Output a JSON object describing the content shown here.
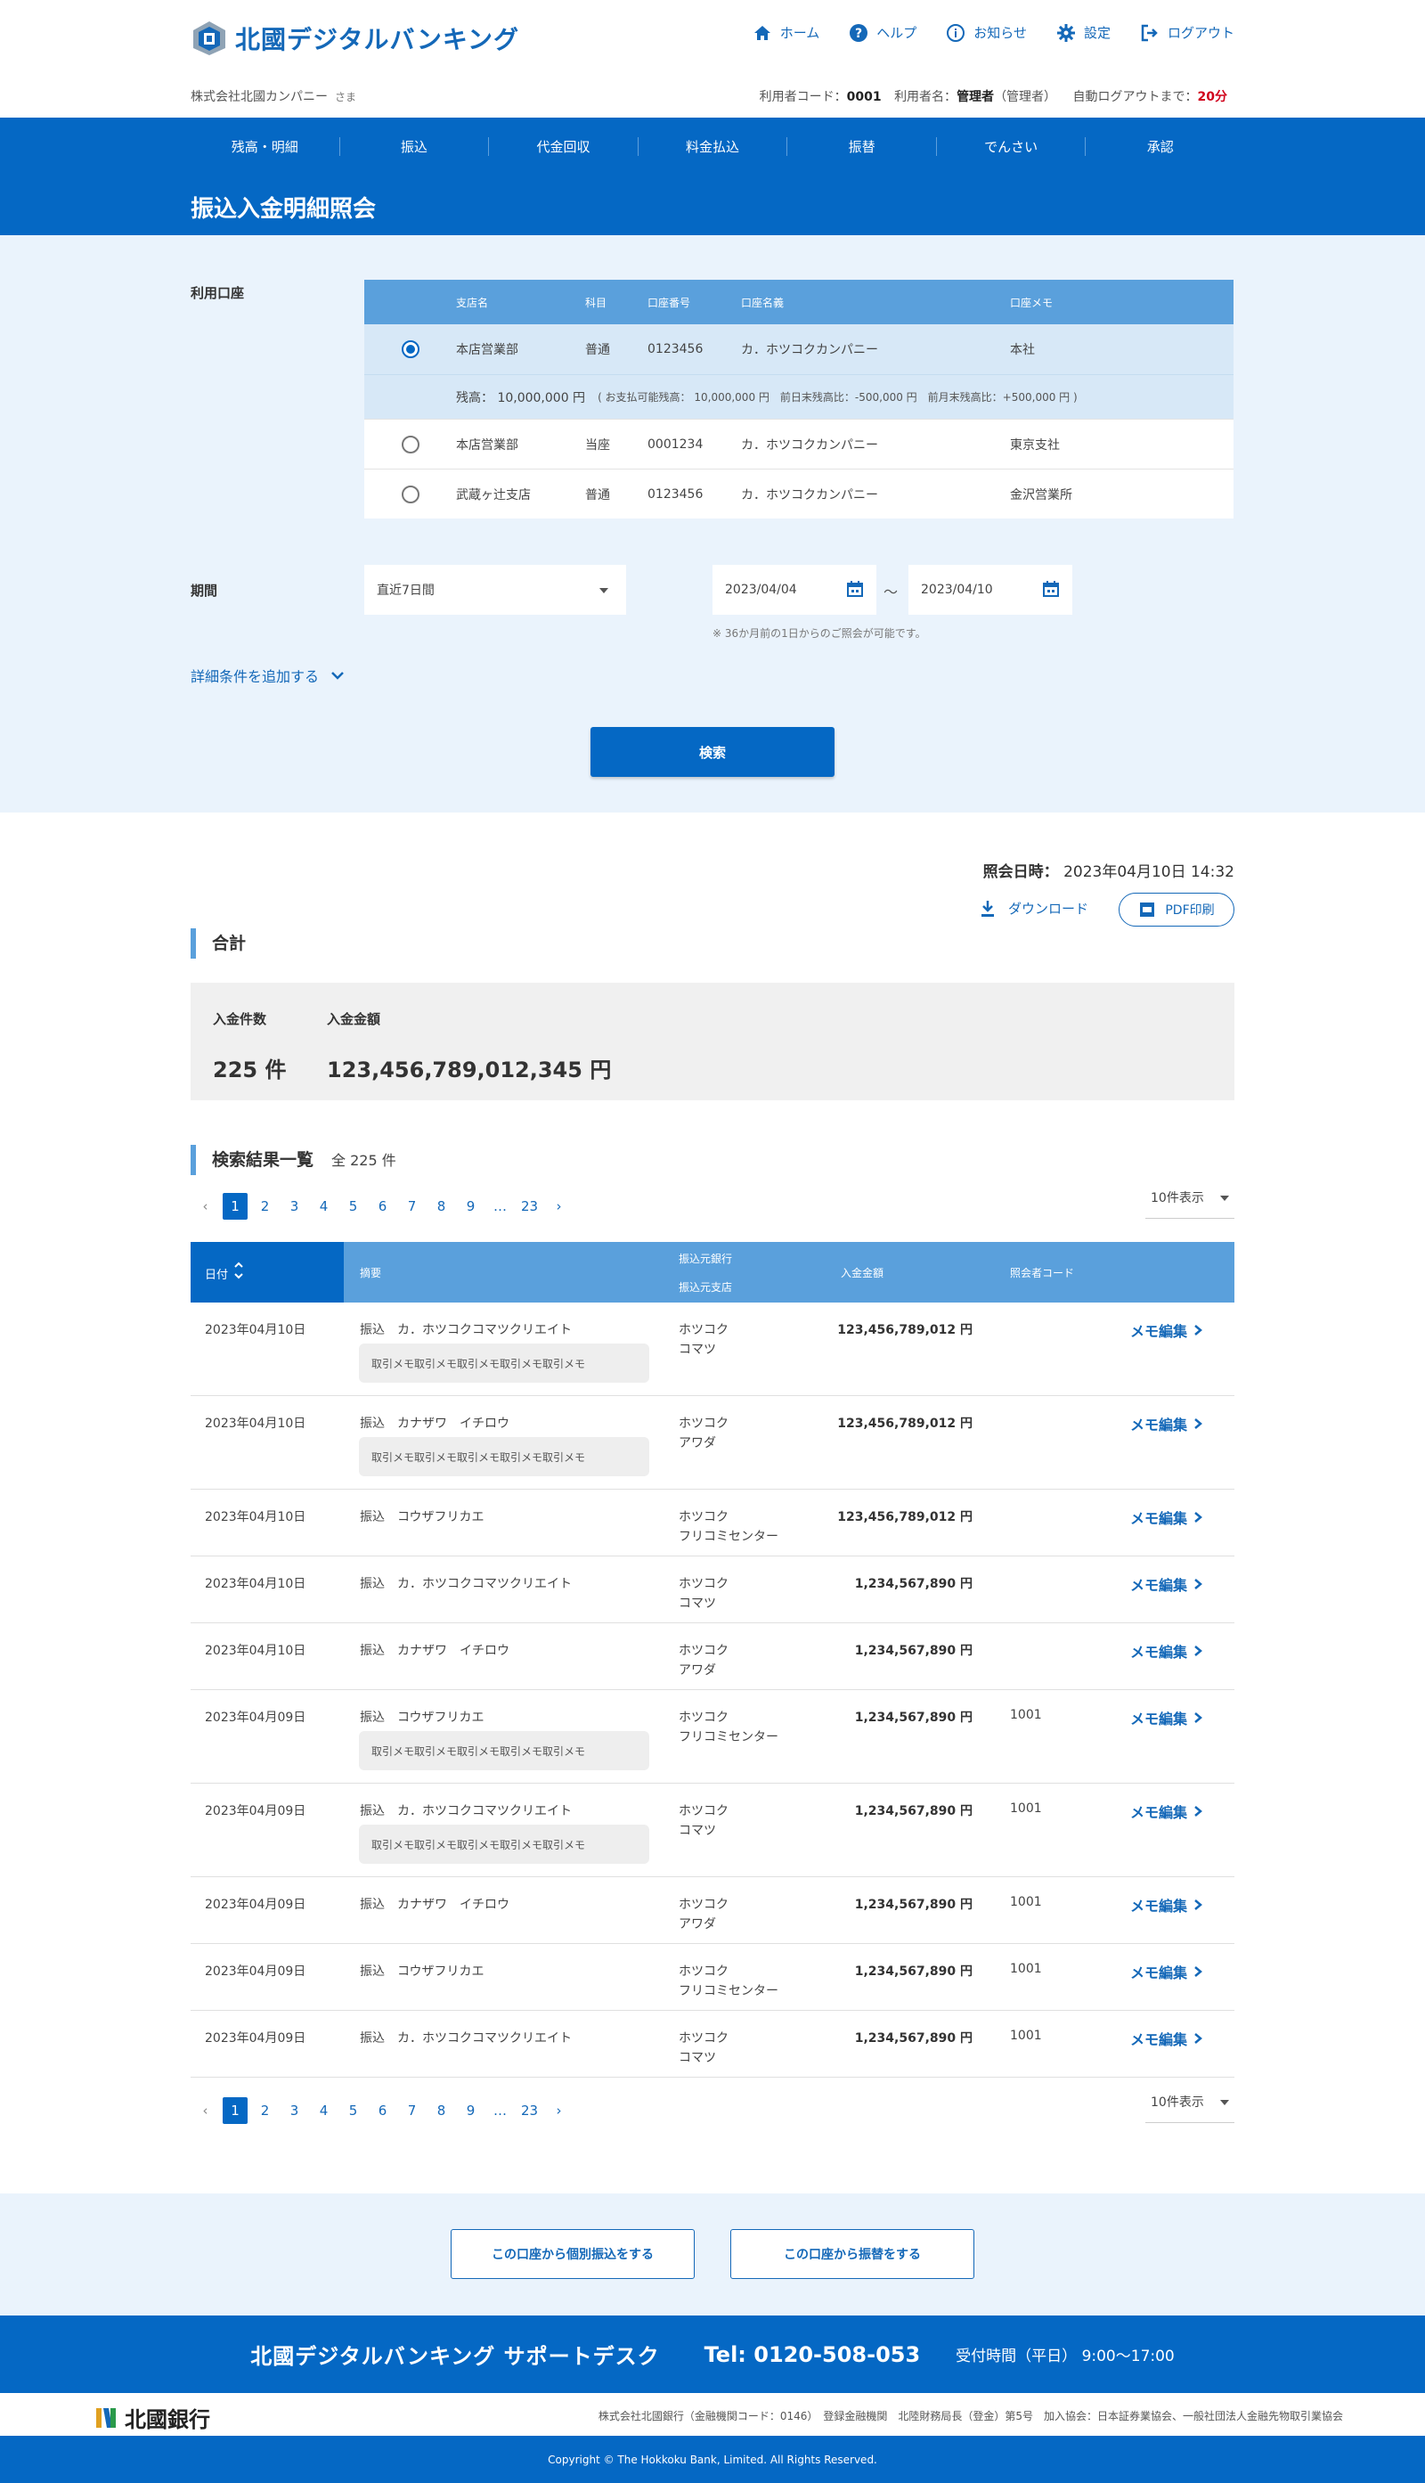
{
  "header": {
    "logo_text": "北國デジタルバンキング",
    "nav": [
      {
        "label": "ホーム",
        "icon": "home-icon"
      },
      {
        "label": "ヘルプ",
        "icon": "help-icon"
      },
      {
        "label": "お知らせ",
        "icon": "info-icon"
      },
      {
        "label": "設定",
        "icon": "gear-icon"
      },
      {
        "label": "ログアウト",
        "icon": "logout-icon"
      }
    ],
    "company_name": "株式会社北國カンパニー",
    "company_suffix": "さま",
    "user_code_label": "利用者コード：",
    "user_code": "0001",
    "user_name_label": "利用者名：",
    "user_name": "管理者",
    "user_role": "（管理者）",
    "auto_logout_label": "自動ログアウトまで：",
    "auto_logout_value": "20分"
  },
  "global_nav": [
    "残高・明細",
    "振込",
    "代金回収",
    "料金払込",
    "振替",
    "でんさい",
    "承認"
  ],
  "page_title": "振込入金明細照会",
  "search": {
    "account_label": "利用口座",
    "account_headers": [
      "支店名",
      "科目",
      "口座番号",
      "口座名義",
      "口座メモ"
    ],
    "accounts": [
      {
        "branch": "本店営業部",
        "type": "普通",
        "number": "0123456",
        "holder": "カ．ホツコクカンパニー",
        "memo": "本社",
        "selected": true
      },
      {
        "branch": "本店営業部",
        "type": "当座",
        "number": "0001234",
        "holder": "カ．ホツコクカンパニー",
        "memo": "東京支社",
        "selected": false
      },
      {
        "branch": "武蔵ヶ辻支店",
        "type": "普通",
        "number": "0123456",
        "holder": "カ．ホツコクカンパニー",
        "memo": "金沢営業所",
        "selected": false
      }
    ],
    "balance_text": "残高： 10,000,000 円",
    "balance_detail": "( お支払可能残高： 10,000,000 円　前日末残高比：-500,000 円　前月末残高比：+500,000 円 )",
    "period_label": "期間",
    "period_select": "直近7日間",
    "date_from": "2023/04/04",
    "date_sep": "～",
    "date_to": "2023/04/10",
    "period_note": "※ 36か月前の1日からのご照会が可能です。",
    "more_conditions": "詳細条件を追加する",
    "search_button": "検索"
  },
  "results": {
    "query_time_label": "照会日時：",
    "query_time": "2023年04月10日 14:32",
    "download_label": "ダウンロード",
    "pdf_label": "PDF印刷",
    "total_title": "合計",
    "count_label": "入金件数",
    "amount_label": "入金金額",
    "count_value": "225 件",
    "amount_value": "123,456,789,012,345 円",
    "list_title": "検索結果一覧",
    "list_count": "全 225 件",
    "pages": [
      "1",
      "2",
      "3",
      "4",
      "5",
      "6",
      "7",
      "8",
      "9",
      "…",
      "23"
    ],
    "per_page": "10件表示",
    "col_date": "日付",
    "col_summary": "摘要",
    "col_bank": "振込元銀行",
    "col_branch": "振込元支店",
    "col_amount": "入金金額",
    "col_code": "照会者コード",
    "rows": [
      {
        "date": "2023年04月10日",
        "summary": "振込　カ．ホツコクコマツクリエイト",
        "memo": "取引メモ取引メモ取引メモ取引メモ取引メモ",
        "bank": "ホツコク",
        "branch": "コマツ",
        "amount": "123,456,789,012 円",
        "code": "",
        "edit": "メモ編集"
      },
      {
        "date": "2023年04月10日",
        "summary": "振込　カナザワ　イチロウ",
        "memo": "取引メモ取引メモ取引メモ取引メモ取引メモ",
        "bank": "ホツコク",
        "branch": "アワダ",
        "amount": "123,456,789,012 円",
        "code": "",
        "edit": "メモ編集"
      },
      {
        "date": "2023年04月10日",
        "summary": "振込　コウザフリカエ",
        "memo": "",
        "bank": "ホツコク",
        "branch": "フリコミセンター",
        "amount": "123,456,789,012 円",
        "code": "",
        "edit": "メモ編集"
      },
      {
        "date": "2023年04月10日",
        "summary": "振込　カ．ホツコクコマツクリエイト",
        "memo": "",
        "bank": "ホツコク",
        "branch": "コマツ",
        "amount": "1,234,567,890 円",
        "code": "",
        "edit": "メモ編集"
      },
      {
        "date": "2023年04月10日",
        "summary": "振込　カナザワ　イチロウ",
        "memo": "",
        "bank": "ホツコク",
        "branch": "アワダ",
        "amount": "1,234,567,890 円",
        "code": "",
        "edit": "メモ編集"
      },
      {
        "date": "2023年04月09日",
        "summary": "振込　コウザフリカエ",
        "memo": "取引メモ取引メモ取引メモ取引メモ取引メモ",
        "bank": "ホツコク",
        "branch": "フリコミセンター",
        "amount": "1,234,567,890 円",
        "code": "1001",
        "edit": "メモ編集"
      },
      {
        "date": "2023年04月09日",
        "summary": "振込　カ．ホツコクコマツクリエイト",
        "memo": "取引メモ取引メモ取引メモ取引メモ取引メモ",
        "bank": "ホツコク",
        "branch": "コマツ",
        "amount": "1,234,567,890 円",
        "code": "1001",
        "edit": "メモ編集"
      },
      {
        "date": "2023年04月09日",
        "summary": "振込　カナザワ　イチロウ",
        "memo": "",
        "bank": "ホツコク",
        "branch": "アワダ",
        "amount": "1,234,567,890 円",
        "code": "1001",
        "edit": "メモ編集"
      },
      {
        "date": "2023年04月09日",
        "summary": "振込　コウザフリカエ",
        "memo": "",
        "bank": "ホツコク",
        "branch": "フリコミセンター",
        "amount": "1,234,567,890 円",
        "code": "1001",
        "edit": "メモ編集"
      },
      {
        "date": "2023年04月09日",
        "summary": "振込　カ．ホツコクコマツクリエイト",
        "memo": "",
        "bank": "ホツコク",
        "branch": "コマツ",
        "amount": "1,234,567,890 円",
        "code": "1001",
        "edit": "メモ編集"
      }
    ]
  },
  "bottom_buttons": [
    "この口座から個別振込をする",
    "この口座から振替をする"
  ],
  "support": {
    "title": "北國デジタルバンキング サポートデスク",
    "tel": "Tel: 0120-508-053",
    "hours": "受付時間（平日） 9:00～17:00"
  },
  "footer": {
    "bank_name": "北國銀行",
    "info": "株式会社北國銀行（金融機関コード：0146）　登録金融機関　北陸財務局長（登金）第5号　加入協会：日本証券業協会、一般社団法人金融先物取引業協会",
    "copyright": "Copyright © The Hokkoku Bank, Limited. All Rights Reserved."
  },
  "colors": {
    "primary": "#0568c4",
    "header_light": "#5aa0dc",
    "bg_light": "#eaf3fc",
    "alert": "#d0021b"
  }
}
